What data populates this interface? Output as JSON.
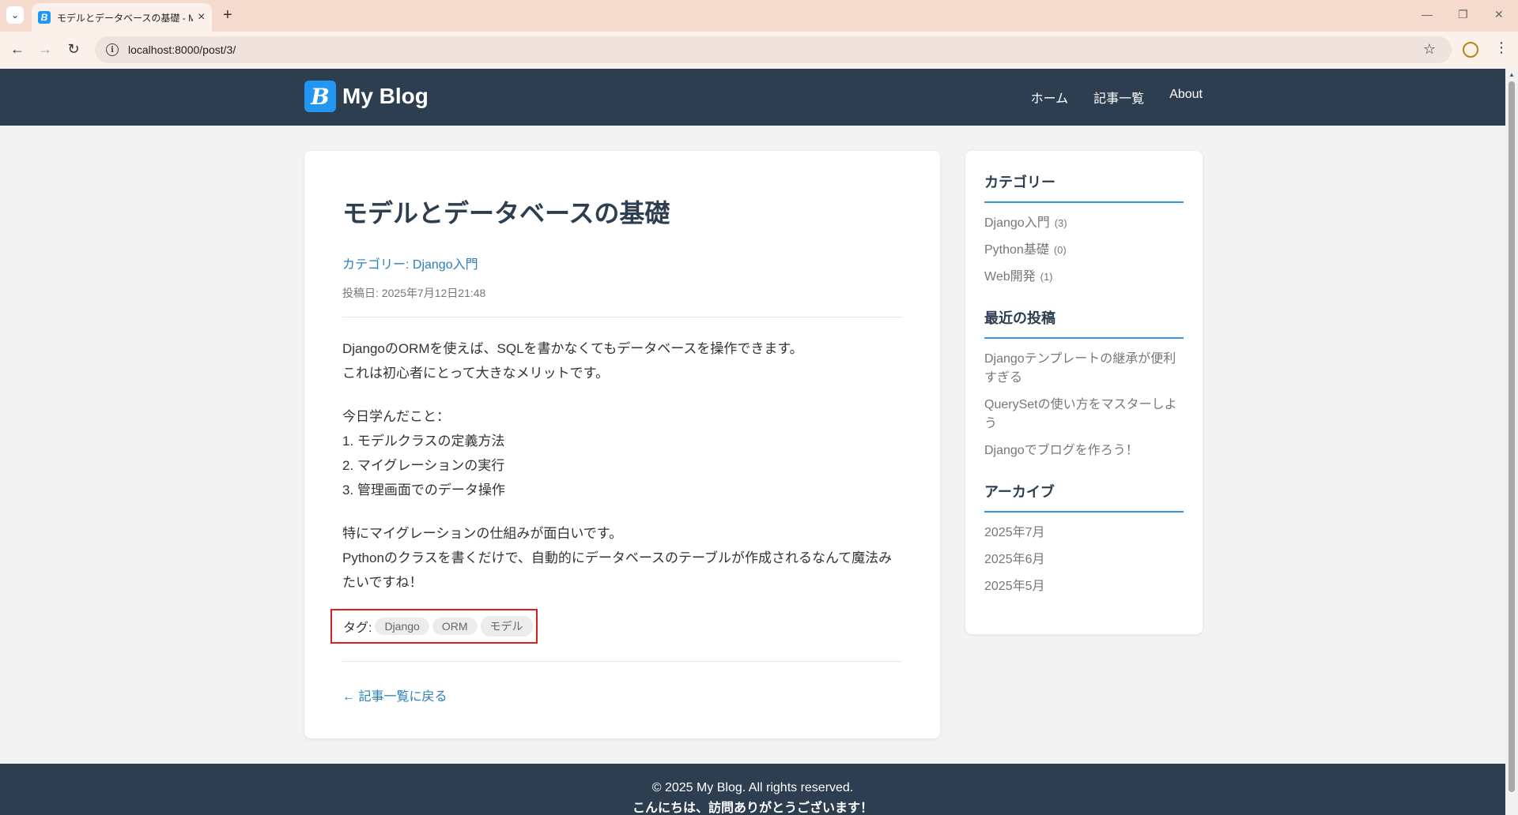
{
  "browser": {
    "tab_title": "モデルとデータベースの基礎 - My Bl",
    "tab_favicon": "B",
    "url": "localhost:8000/post/3/"
  },
  "site": {
    "logo_letter": "B",
    "name": "My Blog",
    "nav": [
      "ホーム",
      "記事一覧",
      "About"
    ]
  },
  "post": {
    "title": "モデルとデータベースの基礎",
    "category": "カテゴリー: Django入門",
    "date": "投稿日: 2025年7月12日21:48",
    "paragraphs": [
      [
        "DjangoのORMを使えば、SQLを書かなくてもデータベースを操作できます。",
        "これは初心者にとって大きなメリットです。"
      ],
      [
        "今日学んだこと：",
        "1. モデルクラスの定義方法",
        "2. マイグレーションの実行",
        "3. 管理画面でのデータ操作"
      ],
      [
        "特にマイグレーションの仕組みが面白いです。",
        "Pythonのクラスを書くだけで、自動的にデータベースのテーブルが作成されるなんて魔法みたいですね！"
      ]
    ],
    "tags_label": "タグ:",
    "tags": [
      "Django",
      "ORM",
      "モデル"
    ],
    "back_link": "← 記事一覧に戻る"
  },
  "sidebar": {
    "categories_heading": "カテゴリー",
    "categories": [
      {
        "name": "Django入門",
        "count": "(3)"
      },
      {
        "name": "Python基礎",
        "count": "(0)"
      },
      {
        "name": "Web開発",
        "count": "(1)"
      }
    ],
    "recent_heading": "最近の投稿",
    "recent": [
      "Djangoテンプレートの継承が便利すぎる",
      "QuerySetの使い方をマスターしよう",
      "Djangoでブログを作ろう！"
    ],
    "archive_heading": "アーカイブ",
    "archive": [
      "2025年7月",
      "2025年6月",
      "2025年5月"
    ]
  },
  "footer": {
    "copyright": "© 2025 My Blog. All rights reserved.",
    "message": "こんにちは、訪問ありがとうございます！"
  },
  "colors": {
    "header_bg": "#2c3e50",
    "accent": "#2980b9",
    "tag_highlight": "#e01e1e"
  }
}
